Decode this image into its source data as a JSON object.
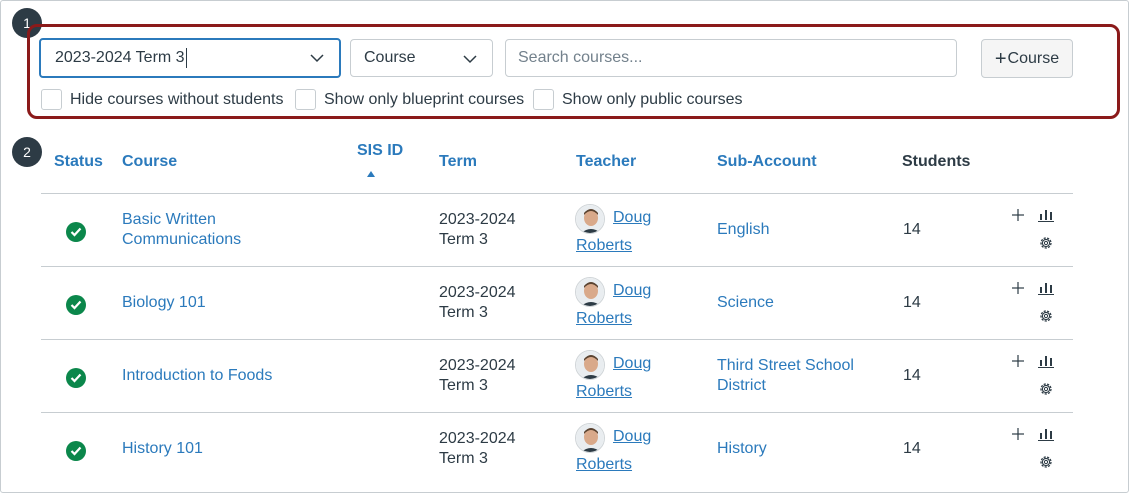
{
  "markers": [
    "1",
    "2"
  ],
  "filters": {
    "term_value": "2023-2024 Term 3",
    "type_value": "Course",
    "search_placeholder": "Search courses...",
    "add_course_plus": "+",
    "add_course_label": "Course",
    "checkboxes": [
      "Hide courses without students",
      "Show only blueprint courses",
      "Show only public courses"
    ]
  },
  "table": {
    "headers": {
      "status": "Status",
      "course": "Course",
      "sis_id": "SIS ID",
      "term": "Term",
      "teacher": "Teacher",
      "sub_account": "Sub-Account",
      "students": "Students"
    },
    "rows": [
      {
        "course_line1": "Basic Written",
        "course_line2": "Communications",
        "term_line1": "2023-2024",
        "term_line2": "Term 3",
        "teacher_first": "Doug",
        "teacher_last": "Roberts",
        "sub_line1": "English",
        "sub_line2": "",
        "students": "14"
      },
      {
        "course_line1": "Biology 101",
        "course_line2": "",
        "term_line1": "2023-2024",
        "term_line2": "Term 3",
        "teacher_first": "Doug",
        "teacher_last": "Roberts",
        "sub_line1": "Science",
        "sub_line2": "",
        "students": "14"
      },
      {
        "course_line1": "Introduction to Foods",
        "course_line2": "",
        "term_line1": "2023-2024",
        "term_line2": "Term 3",
        "teacher_first": "Doug",
        "teacher_last": "Roberts",
        "sub_line1": "Third Street School",
        "sub_line2": "District",
        "students": "14"
      },
      {
        "course_line1": "History 101",
        "course_line2": "",
        "term_line1": "2023-2024",
        "term_line2": "Term 3",
        "teacher_first": "Doug",
        "teacher_last": "Roberts",
        "sub_line1": "History",
        "sub_line2": "",
        "students": "14"
      }
    ],
    "row_icons": [
      "plus-icon",
      "statistics-icon",
      "gear-icon"
    ]
  },
  "colors": {
    "link": "#2b7abc",
    "status_published": "#0b874b",
    "highlight_border": "#8b1a1a",
    "text": "#2d3b45"
  }
}
